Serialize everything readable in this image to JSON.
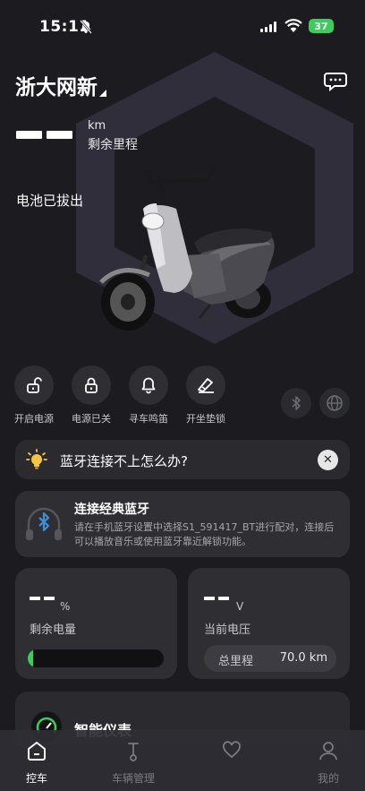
{
  "status_bar": {
    "time": "15:11",
    "battery": "37"
  },
  "header": {
    "title": "浙大网新"
  },
  "range": {
    "value_placeholder": "— —",
    "unit": "km",
    "label": "剩余里程"
  },
  "battery_status": "电池已拔出",
  "controls": [
    {
      "label": "开启电源",
      "icon": "unlock-icon"
    },
    {
      "label": "电源已关",
      "icon": "lock-icon"
    },
    {
      "label": "寻车鸣笛",
      "icon": "bell-icon"
    },
    {
      "label": "开坐垫锁",
      "icon": "seat-lock-icon"
    }
  ],
  "quick_icons": [
    "bluetooth-icon",
    "globe-icon"
  ],
  "banner": {
    "text": "蓝牙连接不上怎么办?"
  },
  "bt_card": {
    "title": "连接经典蓝牙",
    "description": "请在手机蓝牙设置中选择S1_591417_BT进行配对，连接后可以播放音乐或使用蓝牙靠近解锁功能。"
  },
  "battery_card": {
    "value": "— —",
    "unit": "%",
    "label": "剩余电量",
    "level": 0.04
  },
  "voltage_card": {
    "value": "— —",
    "unit": "V",
    "label": "当前电压",
    "odometer_label": "总里程",
    "odometer_value": "70.0 km"
  },
  "dashboard_card": {
    "title": "智能仪表"
  },
  "tabs": [
    {
      "label": "控车",
      "icon": "home-icon",
      "active": true
    },
    {
      "label": "车辆管理",
      "icon": "scooter-icon",
      "active": false
    },
    {
      "label": "",
      "icon": "heart-hand-icon",
      "active": false
    },
    {
      "label": "我的",
      "icon": "profile-icon",
      "active": false
    }
  ],
  "colors": {
    "background": "#1c1c20",
    "card": "#2e2e33",
    "accent_green": "#3ccb5c"
  }
}
